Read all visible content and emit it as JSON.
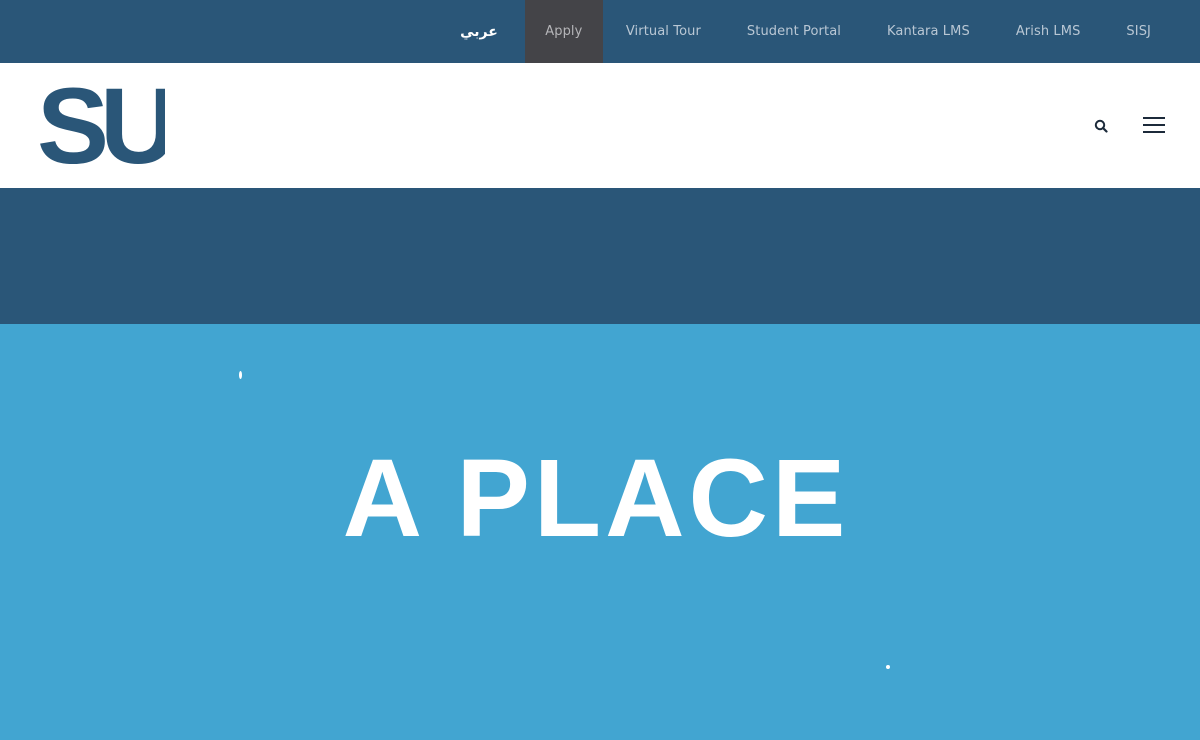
{
  "topbar": {
    "links": [
      {
        "label": "عربي",
        "name": "nav-arabic"
      },
      {
        "label": "Apply",
        "name": "nav-apply"
      },
      {
        "label": "Virtual Tour",
        "name": "nav-virtual-tour"
      },
      {
        "label": "Student Portal",
        "name": "nav-student-portal"
      },
      {
        "label": "Kantara LMS",
        "name": "nav-kantara-lms"
      },
      {
        "label": "Arish LMS",
        "name": "nav-arish-lms"
      },
      {
        "label": "SISJ",
        "name": "nav-sisj"
      }
    ]
  },
  "header": {
    "logo_text": "SU",
    "icons": {
      "search": "search-icon",
      "menu": "hamburger-menu-icon"
    }
  },
  "hero": {
    "headline": "A PLACE"
  },
  "colors": {
    "brand_dark": "#2a5678",
    "hero_light": "#42a5d1",
    "apply_bg": "#444448"
  }
}
